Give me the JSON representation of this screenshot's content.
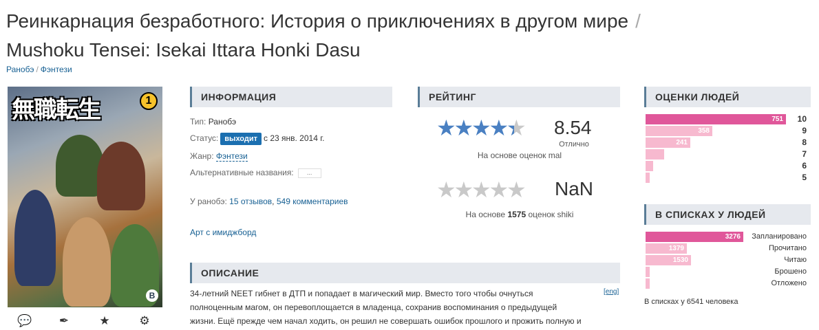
{
  "title": {
    "russian": "Реинкарнация безработного: История о приключениях в другом мире",
    "separator": "/",
    "romaji": "Mushoku Tensei: Isekai Ittara Honki Dasu"
  },
  "breadcrumbs": [
    "Ранобэ",
    "Фэнтези"
  ],
  "poster": {
    "logo_text": "無職転生",
    "volume": "1",
    "publisher_mark": "B"
  },
  "actions": [
    {
      "name": "comments-icon",
      "glyph": "💬"
    },
    {
      "name": "quill-icon",
      "glyph": "✒"
    },
    {
      "name": "star-icon",
      "glyph": "★"
    },
    {
      "name": "gears-icon",
      "glyph": "⚙"
    }
  ],
  "info": {
    "header": "ИНФОРМАЦИЯ",
    "type_label": "Тип:",
    "type_value": "Ранобэ",
    "status_label": "Статус:",
    "status_badge": "выходит",
    "status_date": "с 23 янв. 2014 г.",
    "genre_label": "Жанр:",
    "genre_value": "Фэнтези",
    "alt_names_label": "Альтернативные названия:",
    "alt_names_button": "...",
    "reviews_label": "У ранобэ:",
    "reviews_link": "15 отзывов",
    "comments_link": "549 комментариев",
    "imageboard_link": "Арт с имиджборд"
  },
  "rating": {
    "header": "РЕЙТИНГ",
    "mal_score": "8.54",
    "mal_word": "Отлично",
    "mal_stars": 4.3,
    "mal_note": "На основе оценок mal",
    "shiki_score": "NaN",
    "shiki_stars": 0,
    "shiki_note_prefix": "На основе",
    "shiki_note_count": "1575",
    "shiki_note_suffix": "оценок shiki"
  },
  "description": {
    "header": "ОПИСАНИЕ",
    "eng_link": "[eng]",
    "lines": [
      "34-летний NEET гибнет в ДТП и попадает в магический мир. Вместо того чтобы очнуться",
      "полноценным магом, он перевоплощается в младенца, сохранив воспоминания о предыдущей",
      "жизни. Ещё прежде чем начал ходить, он решил не совершать ошибок прошлого и прожить полную и"
    ]
  },
  "scores": {
    "header": "ОЦЕНКИ ЛЮДЕЙ",
    "items": [
      {
        "label": "10",
        "count": "751",
        "value": 751
      },
      {
        "label": "9",
        "count": "358",
        "value": 358
      },
      {
        "label": "8",
        "count": "241",
        "value": 241
      },
      {
        "label": "7",
        "count": "",
        "value": 100
      },
      {
        "label": "6",
        "count": "",
        "value": 42
      },
      {
        "label": "5",
        "count": "",
        "value": 22
      }
    ]
  },
  "lists": {
    "header": "В СПИСКАХ У ЛЮДЕЙ",
    "items": [
      {
        "label": "Запланировано",
        "count": "3276",
        "value": 3276
      },
      {
        "label": "Прочитано",
        "count": "1379",
        "value": 1379
      },
      {
        "label": "Читаю",
        "count": "1530",
        "value": 1530
      },
      {
        "label": "Брошено",
        "count": "",
        "value": 100
      },
      {
        "label": "Отложено",
        "count": "",
        "value": 100
      }
    ],
    "total": "В списках у 6541 человека"
  },
  "colors": {
    "accent": "#176093",
    "badge": "#1b6fb0",
    "star": "#4a80c2",
    "bar_top": "#e0579a",
    "bar": "#f7b9cf"
  }
}
